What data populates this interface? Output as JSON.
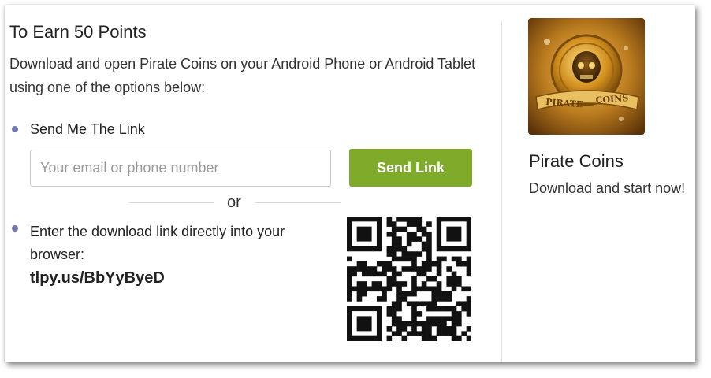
{
  "offer": {
    "heading": "To Earn 50 Points",
    "description": "Download and open Pirate Coins on your Android Phone or Android Tablet using one of the options below:"
  },
  "send_link": {
    "label": "Send Me The Link",
    "input_placeholder": "Your email or phone number",
    "button_label": "Send Link",
    "button_color": "#7faa2a"
  },
  "separator": {
    "text": "or"
  },
  "direct_link": {
    "label": "Enter the download link directly into your browser:",
    "url": "tlpy.us/BbYyByeD",
    "qr_icon": "qr-code-icon"
  },
  "app": {
    "name": "Pirate Coins",
    "tagline": "Download and start now!",
    "icon": "pirate-coin-icon"
  },
  "colors": {
    "bullet": "#6f7bb0",
    "accent": "#7faa2a"
  }
}
